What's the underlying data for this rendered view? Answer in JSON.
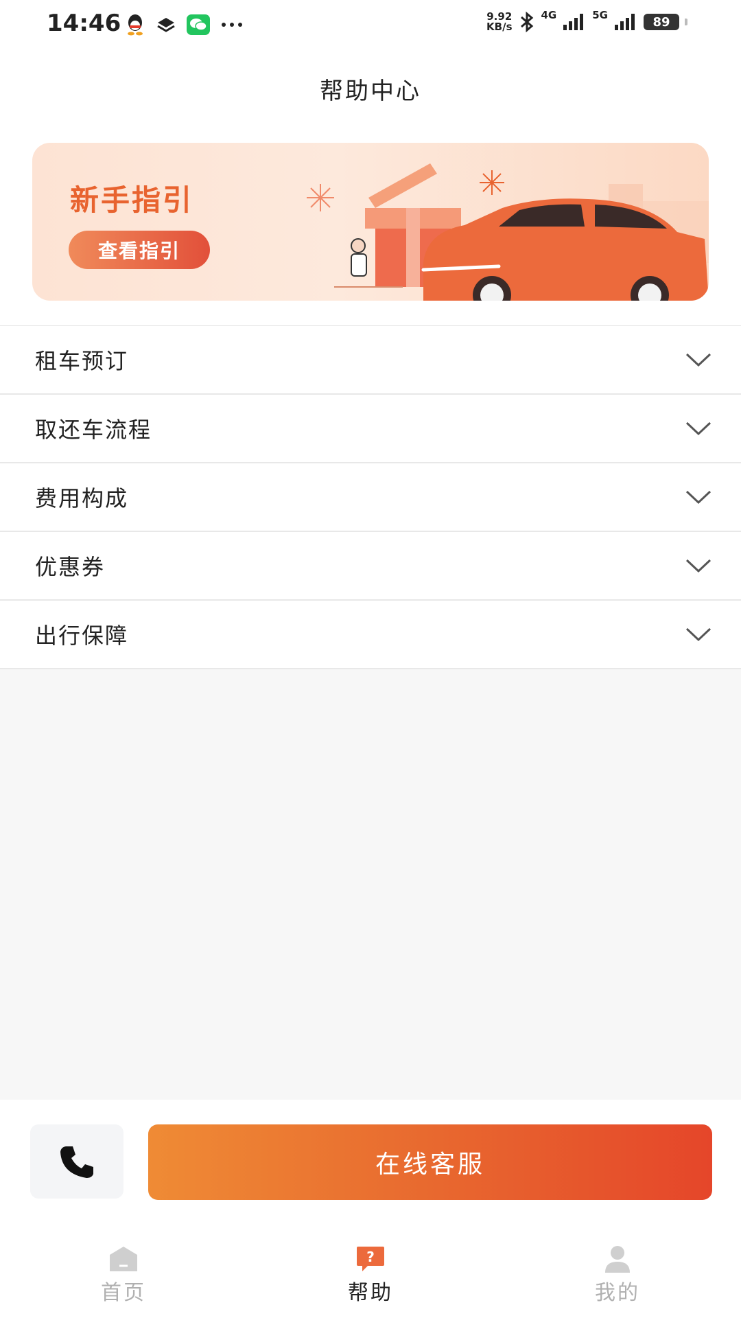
{
  "status_bar": {
    "time": "14:46",
    "net_speed_value": "9.92",
    "net_speed_unit": "KB/s",
    "signal_1_label": "4G",
    "signal_2_label": "5G",
    "battery": "89"
  },
  "header": {
    "title": "帮助中心"
  },
  "banner": {
    "title": "新手指引",
    "button_label": "查看指引",
    "accent_color": "#e8632f"
  },
  "faq": {
    "items": [
      {
        "label": "租车预订"
      },
      {
        "label": "取还车流程"
      },
      {
        "label": "费用构成"
      },
      {
        "label": "优惠券"
      },
      {
        "label": "出行保障"
      }
    ]
  },
  "actions": {
    "phone_icon": "phone-icon",
    "service_label": "在线客服"
  },
  "tabs": {
    "items": [
      {
        "label": "首页",
        "icon": "home-icon",
        "active": false
      },
      {
        "label": "帮助",
        "icon": "help-icon",
        "active": true
      },
      {
        "label": "我的",
        "icon": "user-icon",
        "active": false
      }
    ]
  }
}
